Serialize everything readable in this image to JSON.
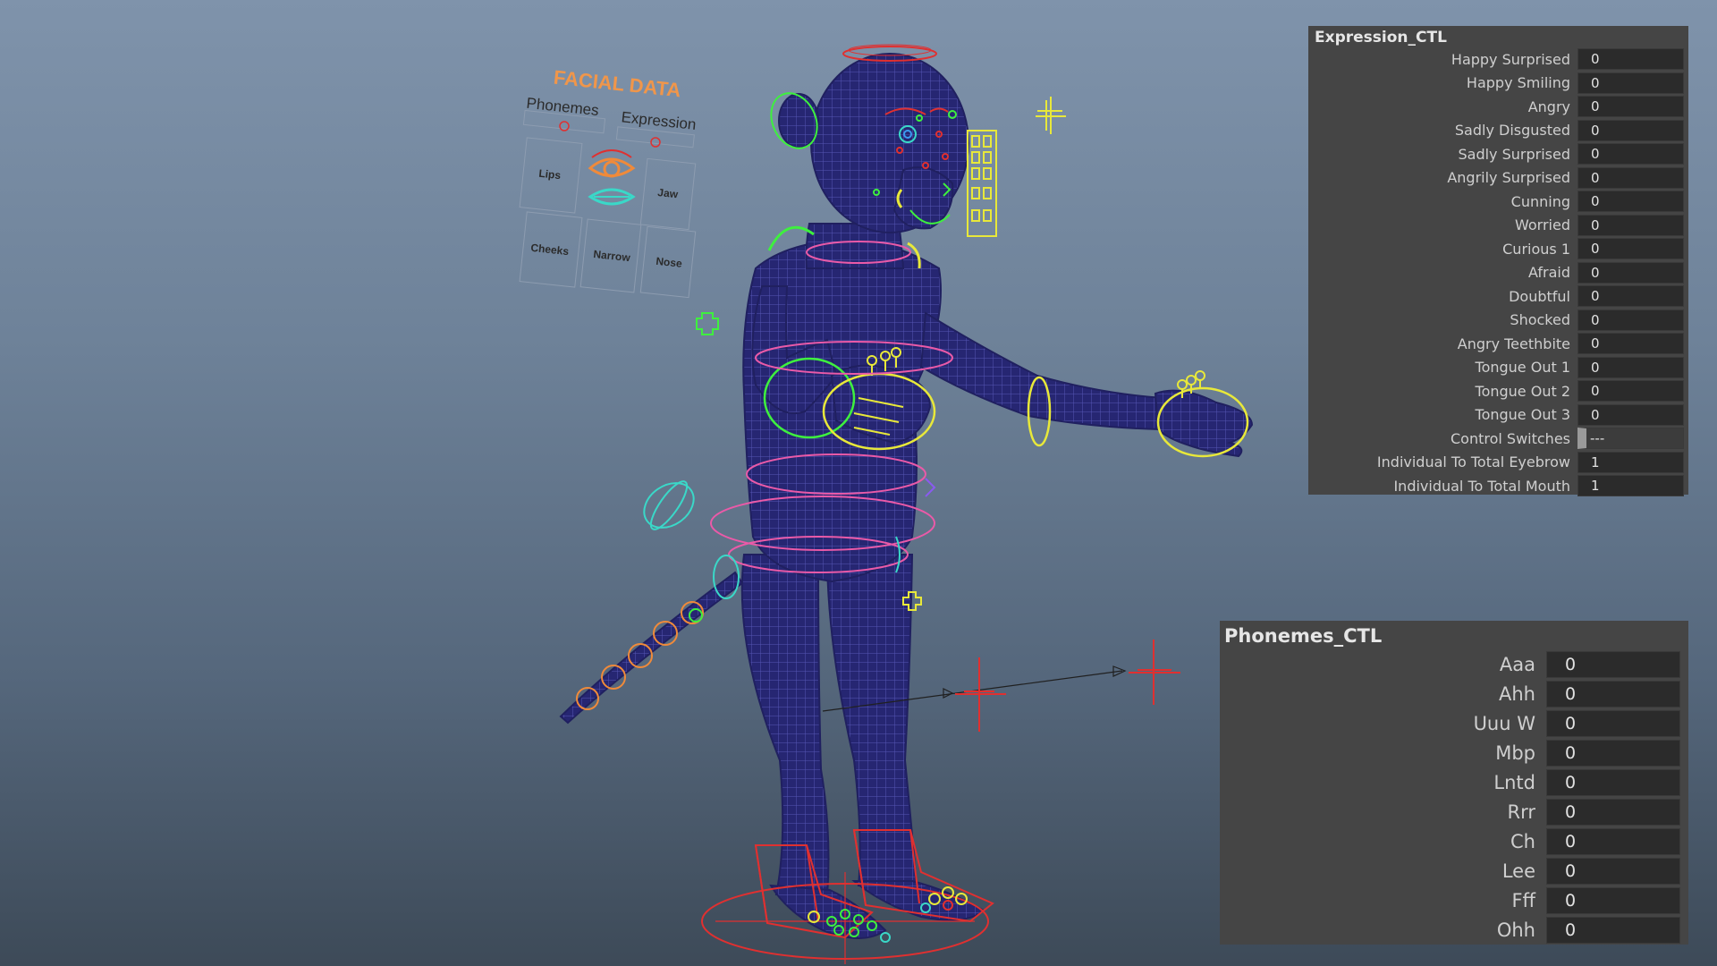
{
  "facial_board": {
    "title": "FACIAL DATA",
    "phonemes_label": "Phonemes",
    "expression_label": "Expression",
    "buttons": [
      "Lips",
      "Jaw",
      "Cheeks",
      "Narrow",
      "Nose"
    ]
  },
  "expression_panel": {
    "title": "Expression_CTL",
    "attributes": [
      {
        "label": "Happy Surprised",
        "value": "0"
      },
      {
        "label": "Happy Smiling",
        "value": "0"
      },
      {
        "label": "Angry",
        "value": "0"
      },
      {
        "label": "Sadly Disgusted",
        "value": "0"
      },
      {
        "label": "Sadly Surprised",
        "value": "0"
      },
      {
        "label": "Angrily Surprised",
        "value": "0"
      },
      {
        "label": "Cunning",
        "value": "0"
      },
      {
        "label": "Worried",
        "value": "0"
      },
      {
        "label": "Curious 1",
        "value": "0"
      },
      {
        "label": "Afraid",
        "value": "0"
      },
      {
        "label": "Doubtful",
        "value": "0"
      },
      {
        "label": "Shocked",
        "value": "0"
      },
      {
        "label": "Angry Teethbite",
        "value": "0"
      },
      {
        "label": "Tongue Out 1",
        "value": "0"
      },
      {
        "label": "Tongue Out 2",
        "value": "0"
      },
      {
        "label": "Tongue Out 3",
        "value": "0"
      },
      {
        "label": "Control Switches",
        "value": "---"
      },
      {
        "label": "Individual To Total Eyebrow",
        "value": "1"
      },
      {
        "label": "Individual To Total Mouth",
        "value": "1"
      }
    ]
  },
  "phonemes_panel": {
    "title": "Phonemes_CTL",
    "attributes": [
      {
        "label": "Aaa",
        "value": "0"
      },
      {
        "label": "Ahh",
        "value": "0"
      },
      {
        "label": "Uuu W",
        "value": "0"
      },
      {
        "label": "Mbp",
        "value": "0"
      },
      {
        "label": "Lntd",
        "value": "0"
      },
      {
        "label": "Rrr",
        "value": "0"
      },
      {
        "label": "Ch",
        "value": "0"
      },
      {
        "label": "Lee",
        "value": "0"
      },
      {
        "label": "Fff",
        "value": "0"
      },
      {
        "label": "Ohh",
        "value": "0"
      }
    ]
  },
  "colors": {
    "mesh": "#2a2a74",
    "wire": "#5a5ab8",
    "ctrl_green": "#3ef03e",
    "ctrl_yellow": "#e8e83a",
    "ctrl_red": "#e03030",
    "ctrl_pink": "#ea5aa8",
    "ctrl_cyan": "#3ad8c8",
    "ctrl_orange": "#f08a3a",
    "board_title": "#f0964a",
    "panel_bg": "#454545"
  }
}
